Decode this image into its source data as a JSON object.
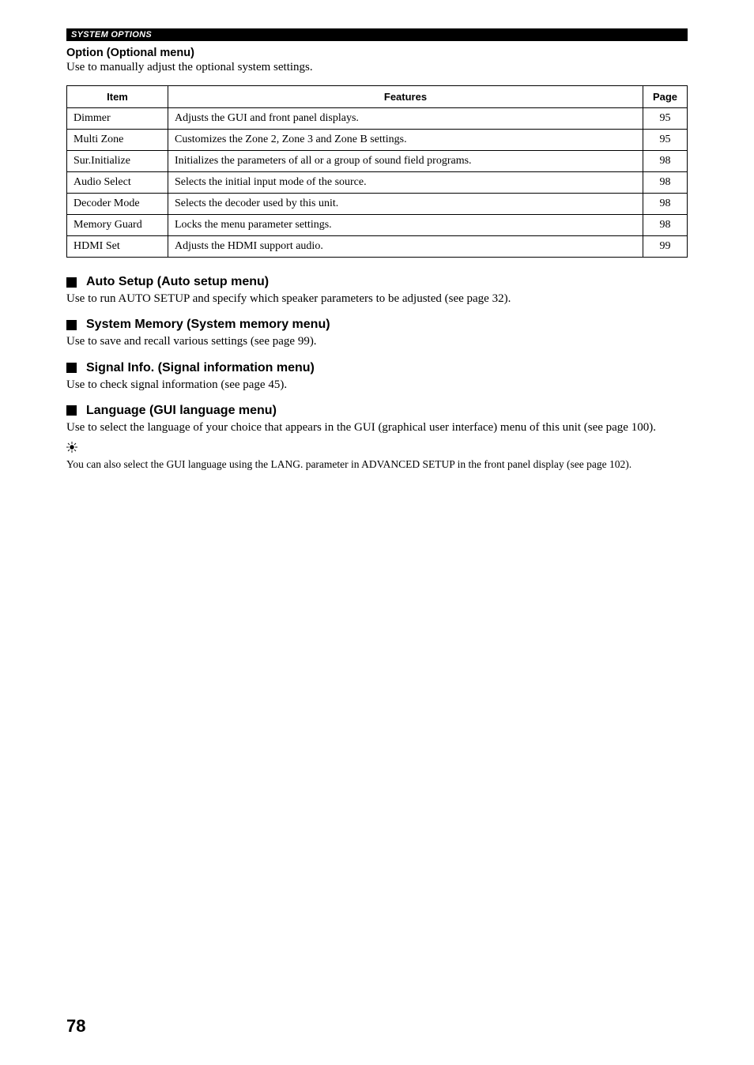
{
  "header_bar": "SYSTEM OPTIONS",
  "option": {
    "title": "Option (Optional menu)",
    "desc": "Use to manually adjust the optional system settings."
  },
  "table": {
    "headers": {
      "item": "Item",
      "features": "Features",
      "page": "Page"
    },
    "rows": [
      {
        "item": "Dimmer",
        "features": "Adjusts the GUI and front panel displays.",
        "page": "95"
      },
      {
        "item": "Multi Zone",
        "features": "Customizes the Zone 2, Zone 3 and Zone B settings.",
        "page": "95"
      },
      {
        "item": "Sur.Initialize",
        "features": "Initializes the parameters of all or a group of sound field programs.",
        "page": "98"
      },
      {
        "item": "Audio Select",
        "features": "Selects the initial input mode of the source.",
        "page": "98"
      },
      {
        "item": "Decoder Mode",
        "features": "Selects the decoder used by this unit.",
        "page": "98"
      },
      {
        "item": "Memory Guard",
        "features": "Locks the menu parameter settings.",
        "page": "98"
      },
      {
        "item": "HDMI Set",
        "features": "Adjusts the HDMI support audio.",
        "page": "99"
      }
    ]
  },
  "auto_setup": {
    "title": "Auto Setup (Auto setup menu)",
    "desc": "Use to run AUTO SETUP and specify which speaker parameters to be adjusted (see page 32)."
  },
  "system_memory": {
    "title": "System Memory (System memory menu)",
    "desc": "Use to save and recall various settings (see page 99)."
  },
  "signal_info": {
    "title": "Signal Info. (Signal information menu)",
    "desc": "Use to check signal information (see page 45)."
  },
  "language": {
    "title": "Language (GUI language menu)",
    "desc": "Use to select the language of your choice that appears in the GUI (graphical user interface) menu of this unit (see page 100)."
  },
  "tip": {
    "text": "You can also select the GUI language using the LANG. parameter in ADVANCED SETUP in the front panel display (see page 102)."
  },
  "page_number": "78"
}
